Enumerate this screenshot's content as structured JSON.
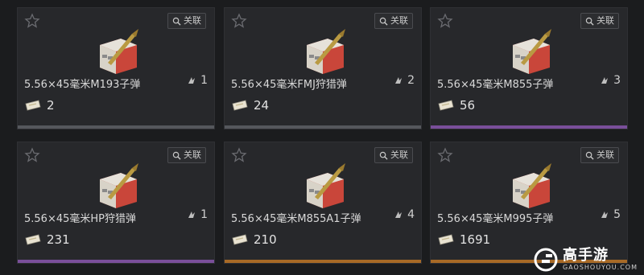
{
  "relation_label": "关联",
  "colors": {
    "grey": "#55575c",
    "purple": "#7a4f9a",
    "orange": "#a86a26"
  },
  "cards": [
    {
      "name": "5.56×45毫米M193子弹",
      "tier": "1",
      "price": "2",
      "bar_color": "#55575c"
    },
    {
      "name": "5.56×45毫米FMJ狩猎弹",
      "tier": "2",
      "price": "24",
      "bar_color": "#55575c"
    },
    {
      "name": "5.56×45毫米M855子弹",
      "tier": "3",
      "price": "56",
      "bar_color": "#7a4f9a"
    },
    {
      "name": "5.56×45毫米HP狩猎弹",
      "tier": "1",
      "price": "231",
      "bar_color": "#7a4f9a"
    },
    {
      "name": "5.56×45毫米M855A1子弹",
      "tier": "4",
      "price": "210",
      "bar_color": "#a86a26"
    },
    {
      "name": "5.56×45毫米M995子弹",
      "tier": "5",
      "price": "1691",
      "bar_color": "#a86a26"
    }
  ],
  "watermark": {
    "title": "高手游",
    "subtitle": "GAOSHOUYOU.COM"
  }
}
